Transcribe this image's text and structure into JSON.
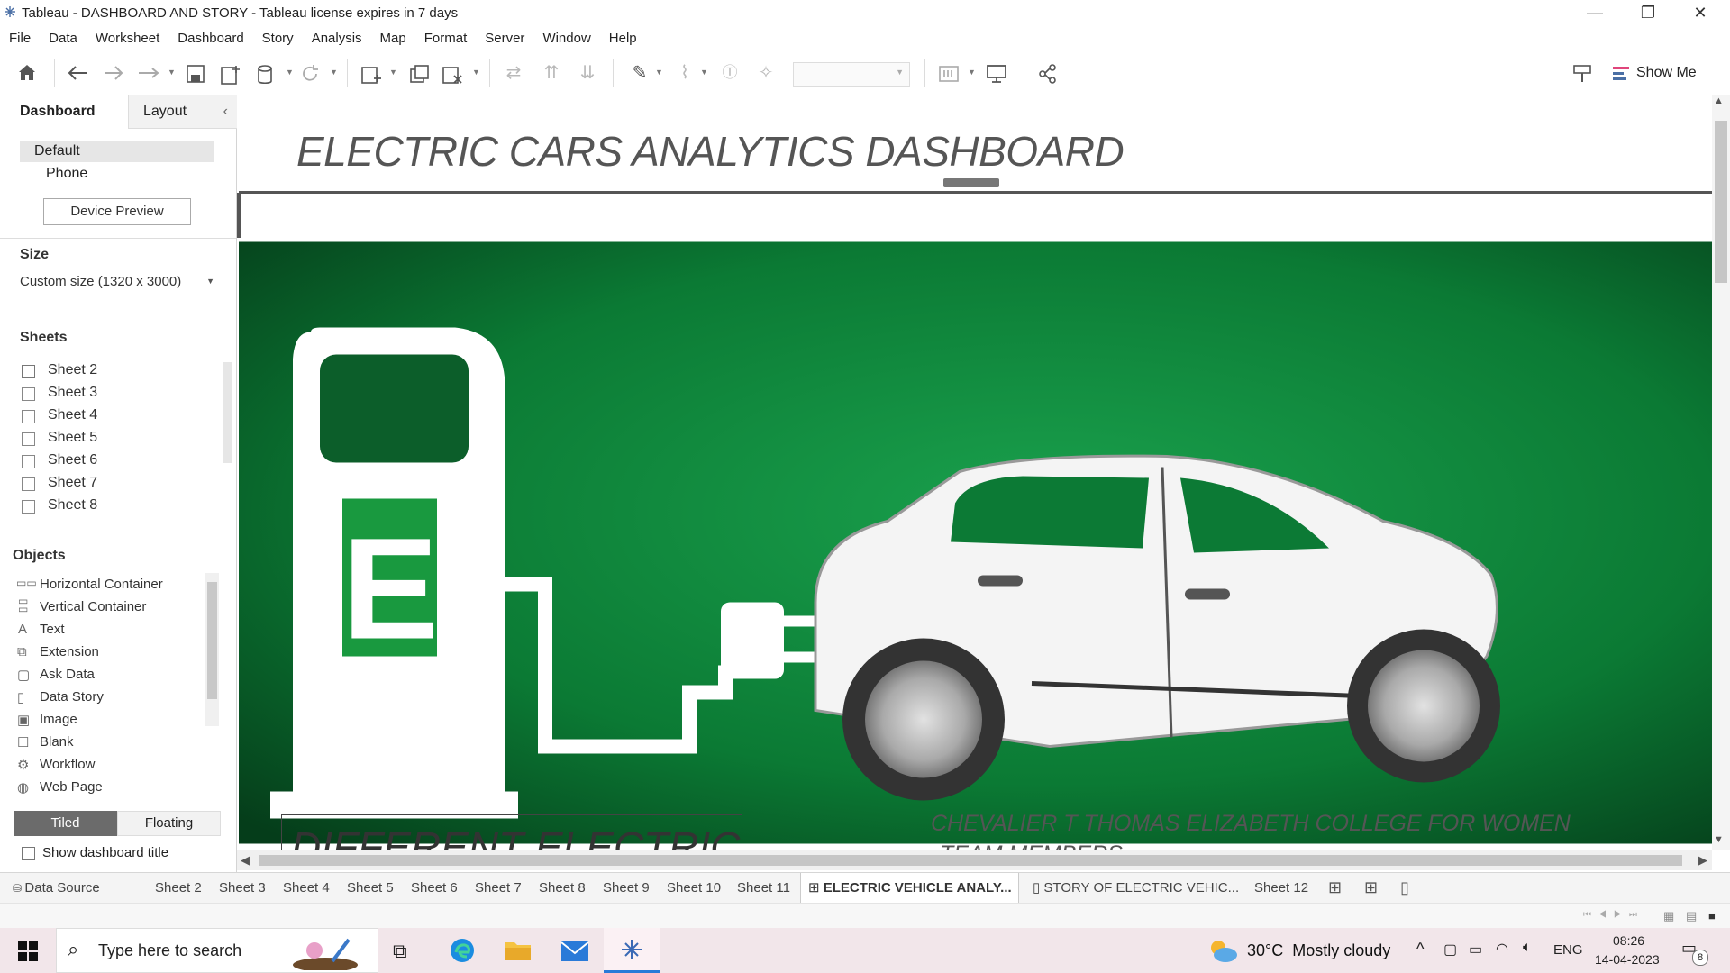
{
  "window": {
    "title": "Tableau - DASHBOARD AND STORY - Tableau license expires in 7 days",
    "minimize": "—",
    "restore": "❐",
    "close": "✕"
  },
  "menu": [
    "File",
    "Data",
    "Worksheet",
    "Dashboard",
    "Story",
    "Analysis",
    "Map",
    "Format",
    "Server",
    "Window",
    "Help"
  ],
  "toolbar": {
    "show_me": "Show Me"
  },
  "left_panel": {
    "tabs": {
      "dashboard": "Dashboard",
      "layout": "Layout"
    },
    "device": {
      "default": "Default",
      "phone": "Phone",
      "preview_button": "Device Preview"
    },
    "size": {
      "title": "Size",
      "value": "Custom size (1320 x 3000)"
    },
    "sheets": {
      "title": "Sheets",
      "items": [
        "Sheet 2",
        "Sheet 3",
        "Sheet 4",
        "Sheet 5",
        "Sheet 6",
        "Sheet 7",
        "Sheet 8"
      ]
    },
    "objects": {
      "title": "Objects",
      "items": [
        "Horizontal Container",
        "Vertical Container",
        "Text",
        "Extension",
        "Ask Data",
        "Data Story",
        "Image",
        "Blank",
        "Workflow",
        "Web Page"
      ],
      "tiled": "Tiled",
      "floating": "Floating",
      "show_title": "Show dashboard title"
    }
  },
  "dashboard": {
    "title": "ELECTRIC CARS ANALYTICS DASHBOARD",
    "hero_letter": "E",
    "box_heading": "DIFFERENT ELECTRIC",
    "college": "CHEVALIER T THOMAS ELIZABETH COLLEGE FOR WOMEN",
    "team": "TEAM MEMBERS",
    "colors": {
      "hero_green": "#0f8a3c",
      "hero_dark": "#053d1a"
    }
  },
  "sheet_tabs": {
    "data_source": "Data Source",
    "sheets": [
      "Sheet 2",
      "Sheet 3",
      "Sheet 4",
      "Sheet 5",
      "Sheet 6",
      "Sheet 7",
      "Sheet 8",
      "Sheet 9",
      "Sheet 10",
      "Sheet 11"
    ],
    "active_dashboard": "ELECTRIC VEHICLE ANALY...",
    "story": "STORY OF ELECTRIC VEHIC...",
    "last_sheet": "Sheet 12"
  },
  "taskbar": {
    "search_placeholder": "Type here to search",
    "weather": "30°C  Mostly cloudy",
    "lang": "ENG",
    "time": "08:26",
    "date": "14-04-2023",
    "notifications": "8"
  }
}
